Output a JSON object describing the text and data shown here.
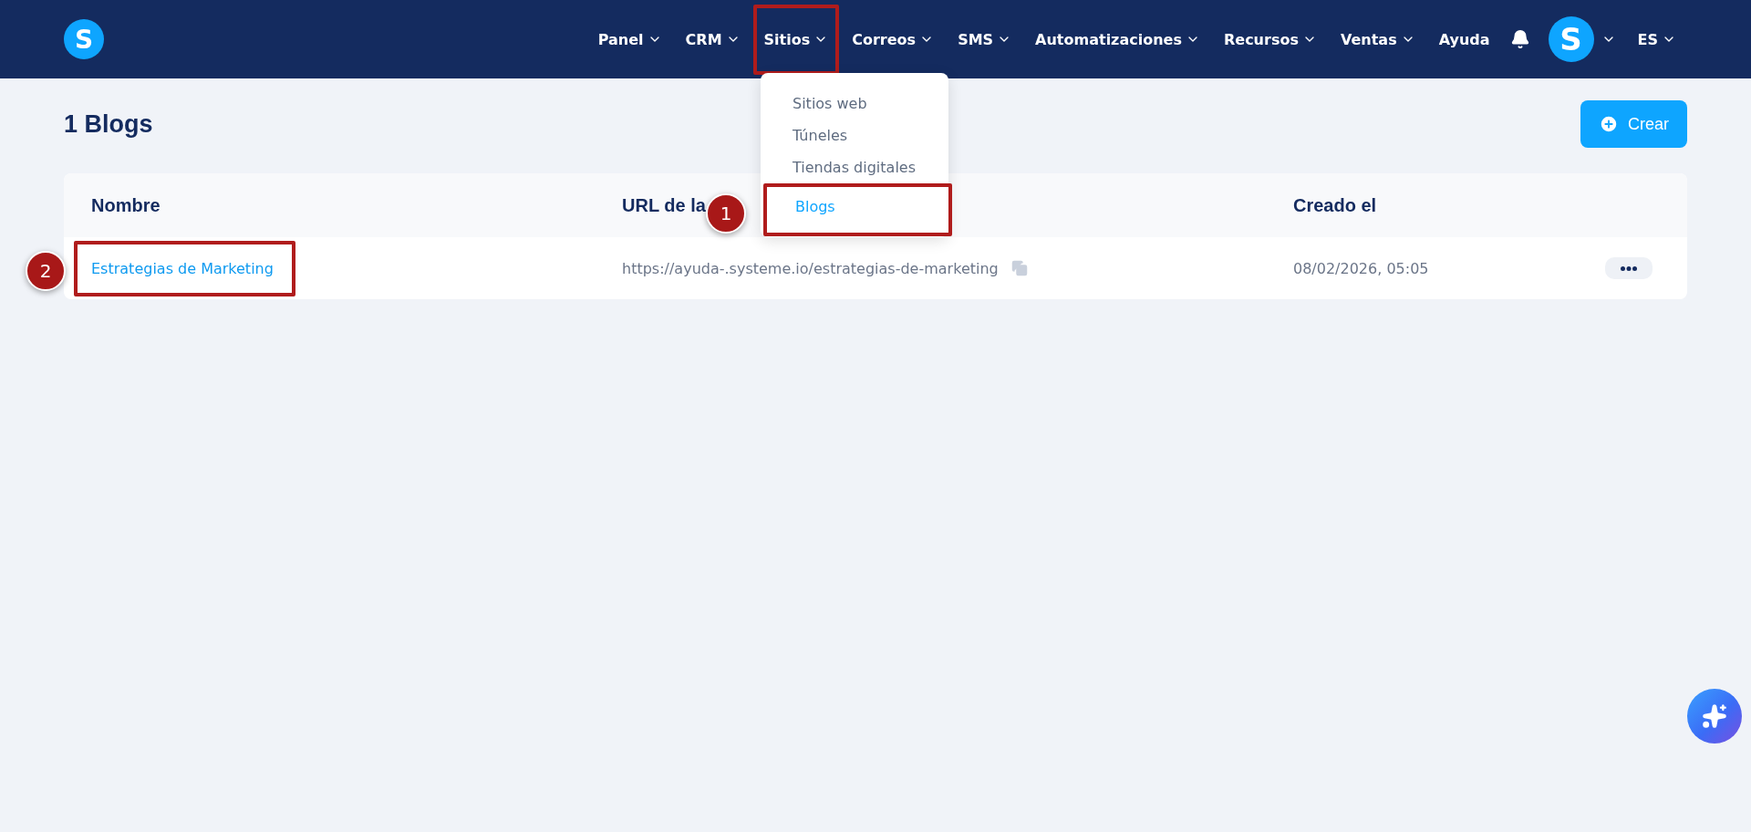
{
  "nav": {
    "items": [
      {
        "label": "Panel",
        "dropdown": true,
        "highlighted": false
      },
      {
        "label": "CRM",
        "dropdown": true,
        "highlighted": false
      },
      {
        "label": "Sitios",
        "dropdown": true,
        "highlighted": true
      },
      {
        "label": "Correos",
        "dropdown": true,
        "highlighted": false
      },
      {
        "label": "SMS",
        "dropdown": true,
        "highlighted": false
      },
      {
        "label": "Automatizaciones",
        "dropdown": true,
        "highlighted": false
      },
      {
        "label": "Recursos",
        "dropdown": true,
        "highlighted": false
      },
      {
        "label": "Ventas",
        "dropdown": true,
        "highlighted": false
      },
      {
        "label": "Ayuda",
        "dropdown": false,
        "highlighted": false
      }
    ],
    "avatar_letter": "S",
    "logo_letter": "S",
    "language": "ES"
  },
  "dropdown_menu": {
    "items": [
      {
        "label": "Sitios web",
        "selected": false,
        "highlighted": false
      },
      {
        "label": "Túneles",
        "selected": false,
        "highlighted": false
      },
      {
        "label": "Tiendas digitales",
        "selected": false,
        "highlighted": false
      },
      {
        "label": "Blogs",
        "selected": true,
        "highlighted": true,
        "callout": "1"
      }
    ]
  },
  "page_title": "1 Blogs",
  "create_button": "Crear",
  "table": {
    "columns": [
      "Nombre",
      "URL de la",
      "Creado el"
    ],
    "rows": [
      {
        "name": "Estrategias de Marketing",
        "highlighted": true,
        "callout": "2",
        "url": "https://ayuda-.systeme.io/estrategias-de-marketing",
        "created": "08/02/2026, 05:05"
      }
    ]
  }
}
